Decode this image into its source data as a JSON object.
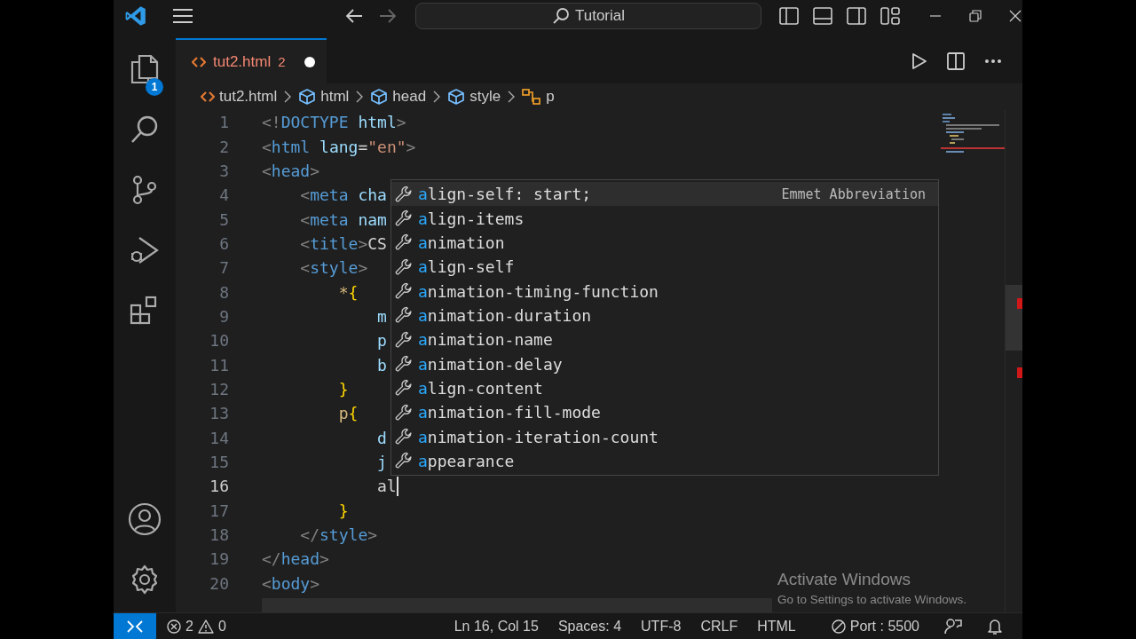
{
  "title_bar": {
    "search": "Tutorial"
  },
  "activity_bar": {
    "explorer_badge": "1"
  },
  "tabs": [
    {
      "label": "tut2.html",
      "problems": "2",
      "modified": true,
      "selected": true
    }
  ],
  "breadcrumbs": [
    {
      "kind": "file",
      "label": "tut2.html"
    },
    {
      "kind": "element",
      "label": "html"
    },
    {
      "kind": "element",
      "label": "head"
    },
    {
      "kind": "element",
      "label": "style"
    },
    {
      "kind": "selector",
      "label": "p"
    }
  ],
  "editor": {
    "lines": [
      {
        "number": "1",
        "current": false,
        "tokens": [
          {
            "kind": "punct",
            "text": "<!"
          },
          {
            "kind": "tag",
            "text": "DOCTYPE"
          },
          {
            "kind": "attr",
            "text": " html"
          },
          {
            "kind": "punct",
            "text": ">"
          }
        ]
      },
      {
        "number": "2",
        "current": false,
        "tokens": [
          {
            "kind": "punct",
            "text": "<"
          },
          {
            "kind": "tag",
            "text": "html"
          },
          {
            "kind": "attr",
            "text": " lang"
          },
          {
            "kind": "text",
            "text": "="
          },
          {
            "kind": "string",
            "text": "\"en\""
          },
          {
            "kind": "punct",
            "text": ">"
          }
        ]
      },
      {
        "number": "3",
        "current": false,
        "tokens": [
          {
            "kind": "punct",
            "text": "<"
          },
          {
            "kind": "tag",
            "text": "head"
          },
          {
            "kind": "punct",
            "text": ">"
          }
        ],
        "children": [
          {
            "number": "4",
            "current": false,
            "tokens": [
              {
                "kind": "punct",
                "text": "<"
              },
              {
                "kind": "tag",
                "text": "meta"
              },
              {
                "kind": "attr",
                "text": " cha"
              }
            ]
          },
          {
            "number": "5",
            "current": false,
            "tokens": [
              {
                "kind": "punct",
                "text": "<"
              },
              {
                "kind": "tag",
                "text": "meta"
              },
              {
                "kind": "attr",
                "text": " nam"
              }
            ]
          },
          {
            "number": "6",
            "current": false,
            "tokens": [
              {
                "kind": "punct",
                "text": "<"
              },
              {
                "kind": "tag",
                "text": "title"
              },
              {
                "kind": "punct",
                "text": ">"
              },
              {
                "kind": "text",
                "text": "CS"
              }
            ]
          },
          {
            "number": "7",
            "current": false,
            "tokens": [
              {
                "kind": "punct",
                "text": "<"
              },
              {
                "kind": "tag",
                "text": "style"
              },
              {
                "kind": "punct",
                "text": ">"
              }
            ],
            "children": [
              {
                "number": "8",
                "current": false,
                "tokens": [
                  {
                    "kind": "selector",
                    "text": "*"
                  },
                  {
                    "kind": "brace",
                    "text": "{"
                  }
                ],
                "children": [
                  {
                    "number": "9",
                    "current": false,
                    "tokens": [
                      {
                        "kind": "prop",
                        "text": "m"
                      }
                    ]
                  },
                  {
                    "number": "10",
                    "current": false,
                    "tokens": [
                      {
                        "kind": "prop",
                        "text": "p"
                      }
                    ]
                  },
                  {
                    "number": "11",
                    "current": false,
                    "tokens": [
                      {
                        "kind": "prop",
                        "text": "b"
                      }
                    ]
                  }
                ]
              },
              {
                "number": "12",
                "current": false,
                "tokens": [
                  {
                    "kind": "brace",
                    "text": "}"
                  }
                ]
              },
              {
                "number": "13",
                "current": false,
                "tokens": [
                  {
                    "kind": "selector",
                    "text": "p"
                  },
                  {
                    "kind": "brace",
                    "text": "{"
                  }
                ],
                "children": [
                  {
                    "number": "14",
                    "current": false,
                    "tokens": [
                      {
                        "kind": "prop",
                        "text": "d"
                      }
                    ]
                  },
                  {
                    "number": "15",
                    "current": false,
                    "tokens": [
                      {
                        "kind": "prop",
                        "text": "j"
                      }
                    ]
                  },
                  {
                    "number": "16",
                    "current": true,
                    "tokens": [
                      {
                        "kind": "text",
                        "text": "al"
                      }
                    ]
                  }
                ]
              },
              {
                "number": "17",
                "current": false,
                "tokens": [
                  {
                    "kind": "brace",
                    "text": "}"
                  }
                ]
              }
            ]
          },
          {
            "number": "18",
            "current": false,
            "tokens": [
              {
                "kind": "punct",
                "text": "</"
              },
              {
                "kind": "tag",
                "text": "style"
              },
              {
                "kind": "punct",
                "text": ">"
              }
            ]
          }
        ]
      },
      {
        "number": "19",
        "current": false,
        "tokens": [
          {
            "kind": "punct",
            "text": "</"
          },
          {
            "kind": "tag",
            "text": "head"
          },
          {
            "kind": "punct",
            "text": ">"
          }
        ]
      },
      {
        "number": "20",
        "current": false,
        "tokens": [
          {
            "kind": "punct",
            "text": "<"
          },
          {
            "kind": "tag",
            "text": "body"
          },
          {
            "kind": "punct",
            "text": ">"
          }
        ]
      }
    ]
  },
  "suggestions": [
    {
      "label": "align-self: start;",
      "detail": "Emmet Abbreviation",
      "selected": true
    },
    {
      "label": "align-items",
      "selected": false
    },
    {
      "label": "animation",
      "selected": false
    },
    {
      "label": "align-self",
      "selected": false
    },
    {
      "label": "animation-timing-function",
      "selected": false
    },
    {
      "label": "animation-duration",
      "selected": false
    },
    {
      "label": "animation-name",
      "selected": false
    },
    {
      "label": "animation-delay",
      "selected": false
    },
    {
      "label": "align-content",
      "selected": false
    },
    {
      "label": "animation-fill-mode",
      "selected": false
    },
    {
      "label": "animation-iteration-count",
      "selected": false
    },
    {
      "label": "appearance",
      "selected": false
    }
  ],
  "status_bar": {
    "errors": "2",
    "warnings": "0",
    "position": "Ln 16, Col 15",
    "indentation": "Spaces: 4",
    "encoding": "UTF-8",
    "line_ending": "CRLF",
    "language": "HTML",
    "port": "Port : 5500"
  },
  "os_notice": {
    "title": "Activate Windows",
    "message": "Go to Settings to activate Windows."
  }
}
